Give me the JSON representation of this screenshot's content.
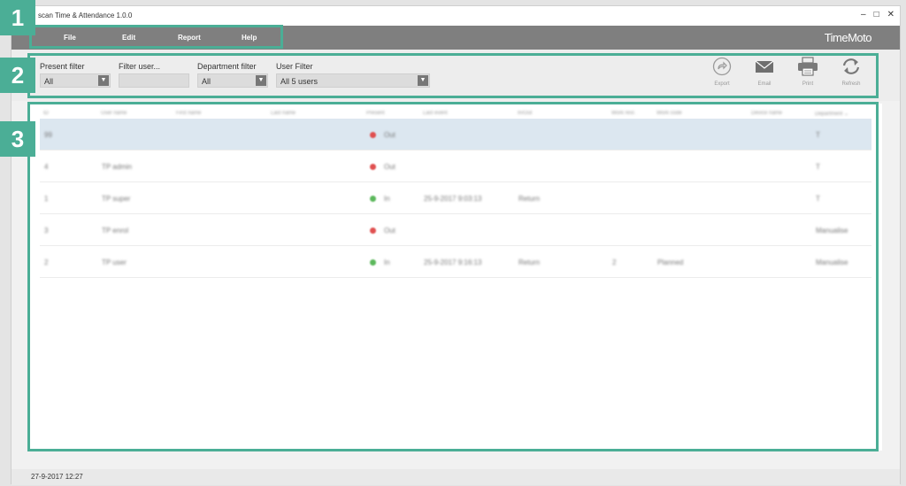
{
  "window": {
    "title": "scan Time & Attendance 1.0.0",
    "controls": [
      "–",
      "□",
      "✕"
    ]
  },
  "menu": {
    "items": [
      "File",
      "Edit",
      "Report",
      "Help"
    ],
    "brand": "TimeMoto"
  },
  "filters": {
    "present_label": "Present filter",
    "present_value": "All",
    "user_label": "Filter user...",
    "user_value": "",
    "department_label": "Department filter",
    "department_value": "All",
    "userfilter_label": "User Filter",
    "userfilter_value": "All 5 users"
  },
  "toolbar": {
    "export": "Export",
    "email": "Email",
    "print": "Print",
    "refresh": "Refresh"
  },
  "table": {
    "columns": [
      "ID",
      "User name",
      "First name",
      "Last name",
      "Present",
      "Last event",
      "In/Out",
      "Work resr.",
      "Work code",
      "Device name",
      "Department ⌄"
    ],
    "rows": [
      {
        "id": "99",
        "user": "",
        "present": "Out",
        "status": "out",
        "last_event": "",
        "inout": "",
        "work_resr": "",
        "work_code": "",
        "dept": "T",
        "selected": true
      },
      {
        "id": "4",
        "user": "TP admin",
        "present": "Out",
        "status": "out",
        "last_event": "",
        "inout": "",
        "work_resr": "",
        "work_code": "",
        "dept": "T",
        "selected": false
      },
      {
        "id": "1",
        "user": "TP super",
        "present": "In",
        "status": "in",
        "last_event": "25-9-2017 9:03:13",
        "inout": "Return",
        "work_resr": "",
        "work_code": "",
        "dept": "T",
        "selected": false
      },
      {
        "id": "3",
        "user": "TP enrol",
        "present": "Out",
        "status": "out",
        "last_event": "",
        "inout": "",
        "work_resr": "",
        "work_code": "",
        "dept": "Manualise",
        "selected": false
      },
      {
        "id": "2",
        "user": "TP user",
        "present": "In",
        "status": "in",
        "last_event": "25-9-2017 9:16:13",
        "inout": "Return",
        "work_resr": "2",
        "work_code": "Planned",
        "dept": "Manualise",
        "selected": false
      }
    ]
  },
  "status": {
    "datetime": "27-9-2017 12:27"
  },
  "callouts": [
    "1",
    "2",
    "3"
  ],
  "colors": {
    "accent": "#4bae96",
    "present_in": "#5cb85c",
    "present_out": "#e05050",
    "menubar": "#7f7f7f"
  }
}
